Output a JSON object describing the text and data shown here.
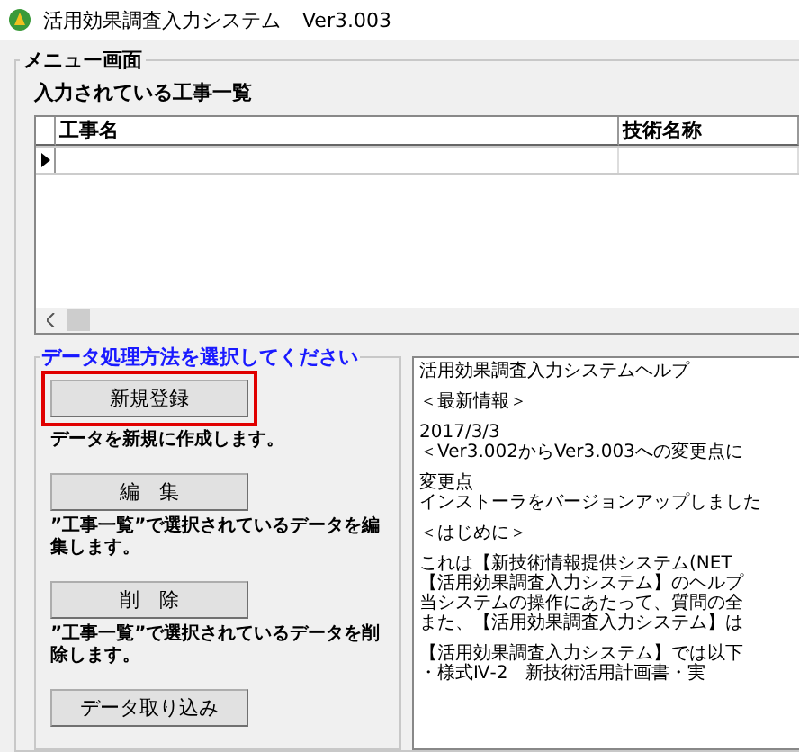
{
  "window": {
    "title": "活用効果調査入力システム",
    "version": "Ver3.003"
  },
  "menu": {
    "title": "メニュー画面",
    "list_label": "入力されている工事一覧",
    "table": {
      "columns": [
        "工事名",
        "技術名称"
      ],
      "rows": [
        {
          "selected": true
        }
      ]
    },
    "actions": {
      "title": "データ処理方法を選択してください",
      "buttons": [
        {
          "label": "新規登録",
          "description": "データを新規に作成します。",
          "highlighted": true
        },
        {
          "label": "編　集",
          "description": "”工事一覧”で選択されているデータを編集します。",
          "highlighted": false
        },
        {
          "label": "削　除",
          "description": "”工事一覧”で選択されているデータを削除します。",
          "highlighted": false
        },
        {
          "label": "データ取り込み",
          "highlighted": false
        }
      ]
    },
    "help": {
      "paragraphs": [
        [
          "活用効果調査入力システムヘルプ"
        ],
        [
          "＜最新情報＞"
        ],
        [
          "2017/3/3",
          "＜Ver3.002からVer3.003への変更点に"
        ],
        [
          "変更点",
          "インストーラをバージョンアップしました"
        ],
        [
          "＜はじめに＞"
        ],
        [
          "これは【新技術情報提供システム(NET",
          "【活用効果調査入力システム】のヘルプ",
          "当システムの操作にあたって、質問の全",
          "また、【活用効果調査入力システム】は"
        ],
        [
          "【活用効果調査入力システム】では以下",
          "・様式Ⅳ-2　新技術活用計画書・実"
        ]
      ]
    }
  }
}
